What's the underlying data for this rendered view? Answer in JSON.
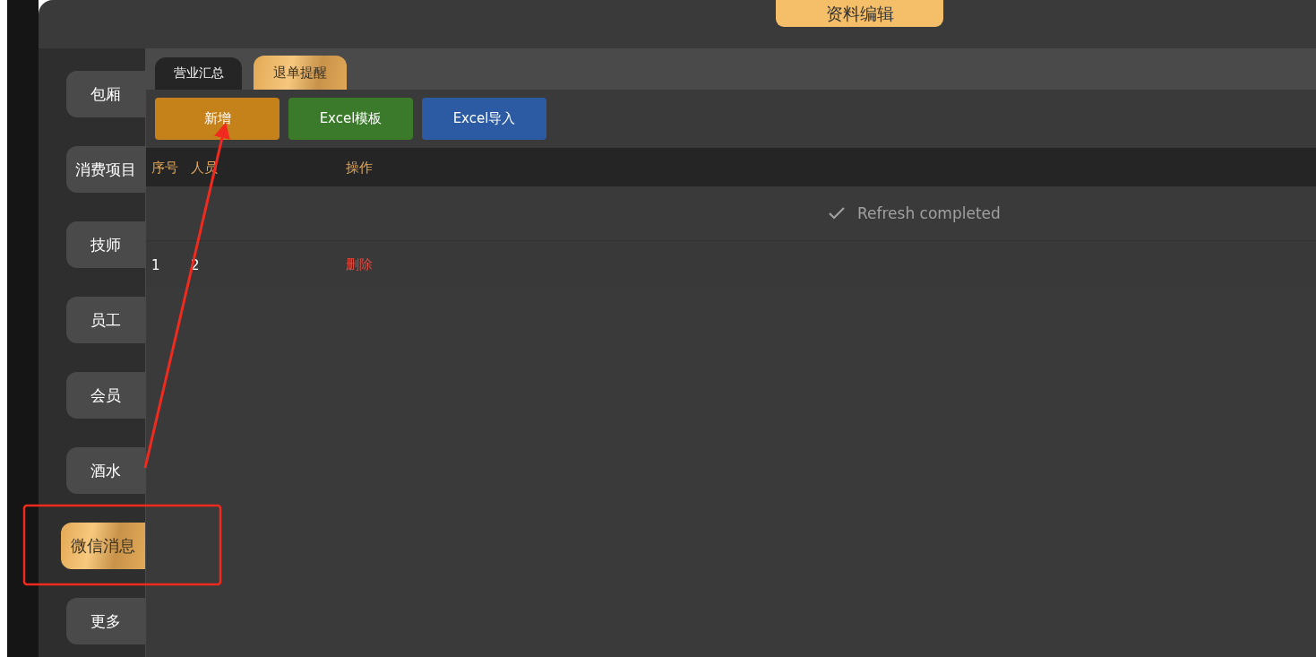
{
  "header": {
    "title": "资料编辑"
  },
  "sidebar": {
    "items": [
      {
        "label": "包厢",
        "selected": false
      },
      {
        "label": "消费项目",
        "selected": false
      },
      {
        "label": "技师",
        "selected": false
      },
      {
        "label": "员工",
        "selected": false
      },
      {
        "label": "会员",
        "selected": false
      },
      {
        "label": "酒水",
        "selected": false
      },
      {
        "label": "微信消息",
        "selected": true
      },
      {
        "label": "更多",
        "selected": false
      }
    ]
  },
  "tabs": [
    {
      "label": "营业汇总",
      "selected": false
    },
    {
      "label": "退单提醒",
      "selected": true
    }
  ],
  "toolbar": {
    "buttons": [
      {
        "label": "新增",
        "kind": "add"
      },
      {
        "label": "Excel模板",
        "kind": "template"
      },
      {
        "label": "Excel导入",
        "kind": "import"
      }
    ]
  },
  "table": {
    "columns": [
      "序号",
      "人员",
      "操作"
    ],
    "notice": "Refresh completed",
    "rows": [
      {
        "cells": [
          "1",
          "2"
        ],
        "action": "删除"
      }
    ]
  }
}
